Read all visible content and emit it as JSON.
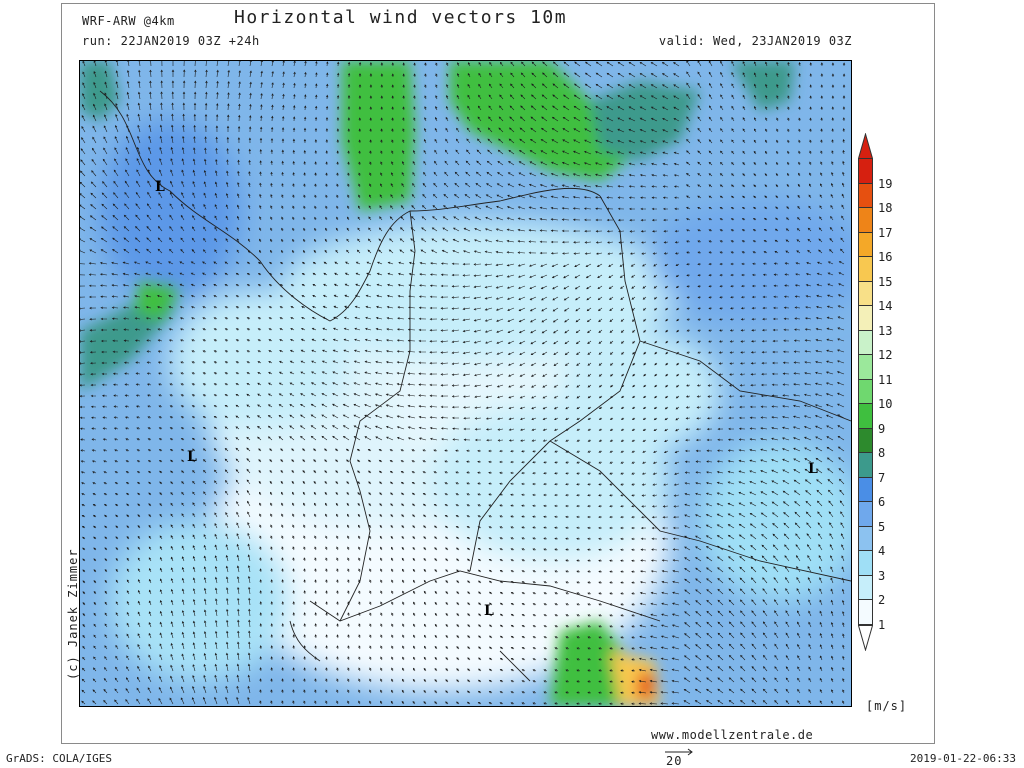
{
  "header": {
    "model": "WRF-ARW @4km",
    "title": "Horizontal wind vectors 10m",
    "run": "run: 22JAN2019 03Z +24h",
    "valid": "valid: Wed, 23JAN2019 03Z"
  },
  "footer": {
    "copyright": "(c) Janek Zimmer",
    "website": "www.modellzentrale.de",
    "software": "GrADS: COLA/IGES",
    "timestamp": "2019-01-22-06:33",
    "reference_vector": "20"
  },
  "colorbar": {
    "unit": "[m/s]",
    "labels": [
      "1",
      "2",
      "3",
      "4",
      "5",
      "6",
      "7",
      "8",
      "9",
      "10",
      "11",
      "12",
      "13",
      "14",
      "15",
      "16",
      "17",
      "18",
      "19"
    ],
    "colors": [
      "#f4fbff",
      "#c6eefa",
      "#9fdff6",
      "#8cc2f0",
      "#6fa8ec",
      "#4a8ee6",
      "#3c9a8c",
      "#2d8a2d",
      "#3fbf3f",
      "#6fd86f",
      "#9be89b",
      "#c9f2c9",
      "#f4f0b8",
      "#f8e088",
      "#f8c850",
      "#f4a828",
      "#ee8418",
      "#e65010",
      "#d62010"
    ]
  },
  "map": {
    "low_labels": [
      "L",
      "L",
      "L",
      "L"
    ]
  }
}
